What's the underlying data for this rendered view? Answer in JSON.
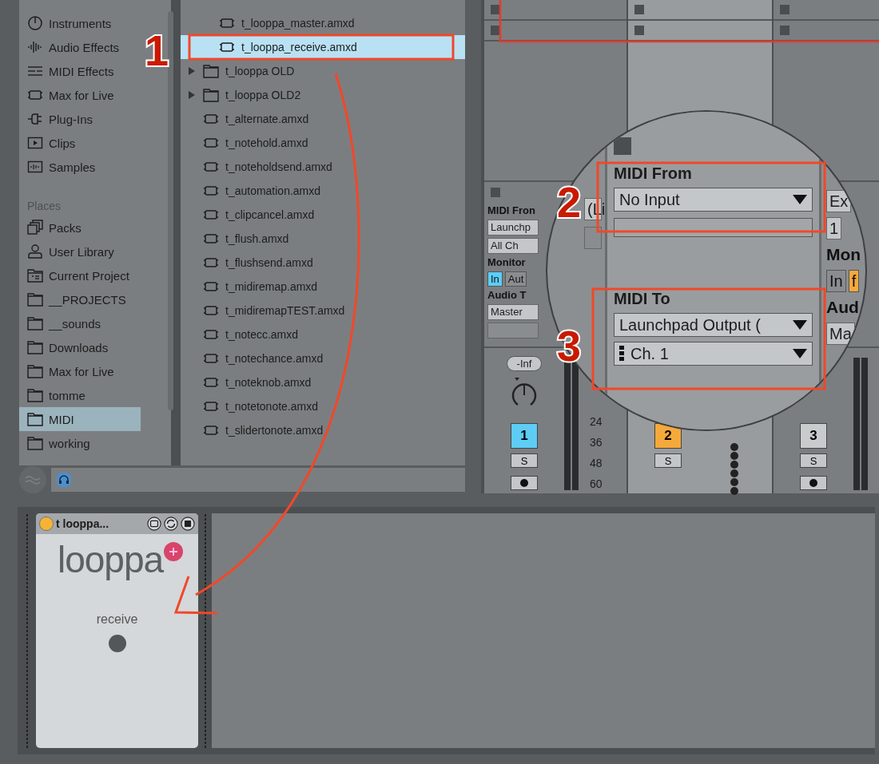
{
  "browser": {
    "categories": [
      {
        "label": "Instruments",
        "kind": "instrument"
      },
      {
        "label": "Audio Effects",
        "kind": "audio"
      },
      {
        "label": "MIDI Effects",
        "kind": "midi"
      },
      {
        "label": "Max for Live",
        "kind": "maxdevice"
      },
      {
        "label": "Plug-Ins",
        "kind": "plug"
      },
      {
        "label": "Clips",
        "kind": "clip"
      },
      {
        "label": "Samples",
        "kind": "sample"
      }
    ],
    "places_heading": "Places",
    "places": [
      {
        "label": "Packs",
        "kind": "packs",
        "selected": false
      },
      {
        "label": "User Library",
        "kind": "user",
        "selected": false
      },
      {
        "label": "Current Project",
        "kind": "project",
        "selected": false
      },
      {
        "label": "__PROJECTS",
        "kind": "folder",
        "selected": false
      },
      {
        "label": "__sounds",
        "kind": "folder",
        "selected": false
      },
      {
        "label": "Downloads",
        "kind": "folder",
        "selected": false
      },
      {
        "label": "Max for Live",
        "kind": "folder",
        "selected": false
      },
      {
        "label": "tomme",
        "kind": "folder",
        "selected": false
      },
      {
        "label": "MIDI",
        "kind": "folder",
        "selected": true
      },
      {
        "label": "working",
        "kind": "folder",
        "selected": false
      }
    ],
    "files": [
      {
        "name": "t_looppa_master.amxd",
        "kind": "device",
        "nested": true,
        "selected": false
      },
      {
        "name": "t_looppa_receive.amxd",
        "kind": "device",
        "nested": true,
        "selected": true
      },
      {
        "name": "t_looppa OLD",
        "kind": "folder",
        "nested": false,
        "selected": false
      },
      {
        "name": "t_looppa OLD2",
        "kind": "folder",
        "nested": false,
        "selected": false
      },
      {
        "name": "t_alternate.amxd",
        "kind": "device",
        "nested": false,
        "selected": false
      },
      {
        "name": "t_notehold.amxd",
        "kind": "device",
        "nested": false,
        "selected": false
      },
      {
        "name": "t_noteholdsend.amxd",
        "kind": "device",
        "nested": false,
        "selected": false
      },
      {
        "name": "t_automation.amxd",
        "kind": "device",
        "nested": false,
        "selected": false
      },
      {
        "name": "t_clipcancel.amxd",
        "kind": "device",
        "nested": false,
        "selected": false
      },
      {
        "name": "t_flush.amxd",
        "kind": "device",
        "nested": false,
        "selected": false
      },
      {
        "name": "t_flushsend.amxd",
        "kind": "device",
        "nested": false,
        "selected": false
      },
      {
        "name": "t_midiremap.amxd",
        "kind": "device",
        "nested": false,
        "selected": false
      },
      {
        "name": "t_midiremapTEST.amxd",
        "kind": "device",
        "nested": false,
        "selected": false
      },
      {
        "name": "t_notecc.amxd",
        "kind": "device",
        "nested": false,
        "selected": false
      },
      {
        "name": "t_notechance.amxd",
        "kind": "device",
        "nested": false,
        "selected": false
      },
      {
        "name": "t_noteknob.amxd",
        "kind": "device",
        "nested": false,
        "selected": false
      },
      {
        "name": "t_notetonote.amxd",
        "kind": "device",
        "nested": false,
        "selected": false
      },
      {
        "name": "t_slidertonote.amxd",
        "kind": "device",
        "nested": false,
        "selected": false
      }
    ]
  },
  "mixer": {
    "tracks": [
      {
        "io": [
          {
            "kind": "label",
            "text": "MIDI Fron"
          },
          {
            "kind": "dropdown",
            "text": "Launchp"
          },
          {
            "kind": "channel",
            "text": "All Ch"
          },
          {
            "kind": "label",
            "text": "Monitor"
          },
          {
            "kind": "buttons",
            "items": [
              {
                "text": "In",
                "selected": true
              },
              {
                "text": "Aut",
                "selected": false
              }
            ]
          },
          {
            "kind": "label",
            "text": "Audio T"
          },
          {
            "kind": "dropdown",
            "text": "Master"
          },
          {
            "kind": "empty"
          }
        ],
        "volume": "-Inf",
        "number": "1",
        "color": "#5dcdf5",
        "solo": "S",
        "arm_button": true,
        "meter_scale": [
          "24",
          "36",
          "48",
          "60"
        ]
      },
      {
        "number": "2",
        "color": "#f5a93b",
        "solo": "S",
        "arm_button": false
      },
      {
        "number": "3",
        "color": "#c9cccd",
        "solo": "S",
        "arm_button": true
      }
    ]
  },
  "magnifier": {
    "left": [
      {
        "kind": "dropdown",
        "text": "(Li"
      },
      {
        "kind": "empty"
      }
    ],
    "midi_from_label": "MIDI From",
    "midi_from_value": "No Input",
    "midi_to_label": "MIDI To",
    "midi_to_value": "Launchpad Output (",
    "channel": "Ch. 1",
    "right": [
      {
        "kind": "dropdown",
        "text": "Ex"
      },
      {
        "kind": "channel",
        "text": "1"
      },
      {
        "kind": "label",
        "text": "Mon"
      },
      {
        "kind": "buttons",
        "items": [
          {
            "text": "In",
            "selected": false
          },
          {
            "text": "f",
            "selected": true
          }
        ]
      },
      {
        "kind": "label",
        "text": "Aud"
      },
      {
        "kind": "dropdown",
        "text": "Ma"
      }
    ]
  },
  "device": {
    "title": "t  looppa...",
    "on": true,
    "logo": "looppa",
    "control_label": "receive"
  },
  "annotations": [
    {
      "number": "1"
    },
    {
      "number": "2"
    },
    {
      "number": "3"
    }
  ]
}
